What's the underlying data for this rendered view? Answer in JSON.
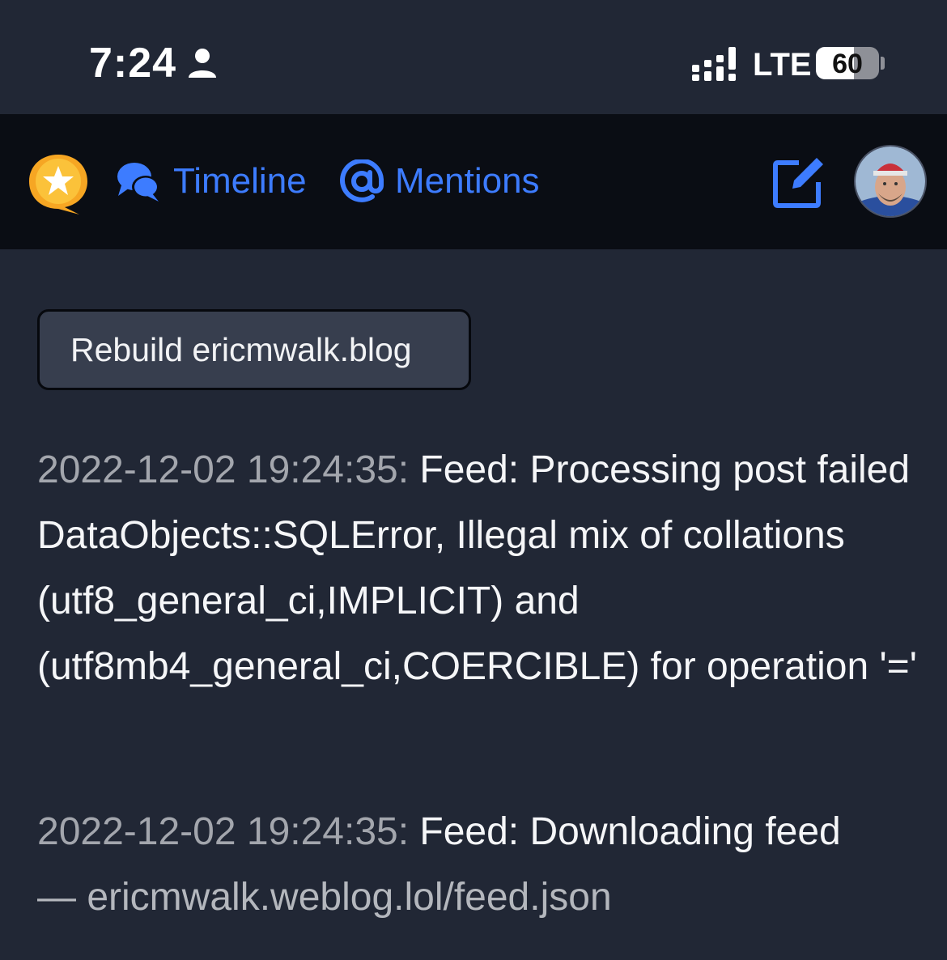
{
  "status_bar": {
    "time": "7:24",
    "network": "LTE",
    "battery_level": "60",
    "battery_fraction": 0.6,
    "icons": [
      "person-icon",
      "signal-icon",
      "battery-icon"
    ]
  },
  "nav": {
    "logo_icon": "star-bubble-logo-icon",
    "items": [
      {
        "label": "Timeline",
        "icon": "chat-bubbles-icon"
      },
      {
        "label": "Mentions",
        "icon": "at-sign-icon"
      }
    ],
    "compose_icon": "compose-icon",
    "avatar_icon": "avatar",
    "accent_color": "#3d7cff"
  },
  "main": {
    "rebuild_button_label": "Rebuild ericmwalk.blog",
    "logs": [
      {
        "timestamp": "2022-12-02 19:24:35:",
        "message": "Feed: Processing post failed DataObjects::SQLError, Illegal mix of collations (utf8_general_ci,IMPLICIT) and (utf8mb4_general_ci,COERCIBLE) for operation '='",
        "detail": ""
      },
      {
        "timestamp": "2022-12-02 19:24:35:",
        "message": "Feed: Downloading feed",
        "detail": "— ericmwalk.weblog.lol/feed.json"
      }
    ]
  }
}
